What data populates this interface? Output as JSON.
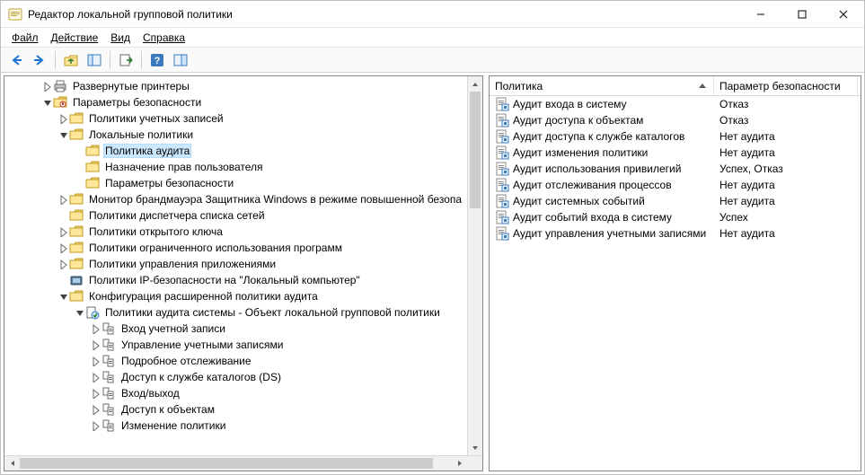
{
  "window": {
    "title": "Редактор локальной групповой политики"
  },
  "menu": {
    "file": "Файл",
    "action": "Действие",
    "view": "Вид",
    "help": "Справка"
  },
  "columns": {
    "policy": "Политика",
    "security": "Параметр безопасности"
  },
  "col_w": {
    "policy": 250,
    "security": 160
  },
  "tree": [
    {
      "depth": 1,
      "data_name": "tree-item-printers",
      "tw": "closed",
      "icon": "printer",
      "label": "Развернутые принтеры"
    },
    {
      "depth": 1,
      "data_name": "tree-item-security-settings",
      "tw": "open",
      "icon": "security",
      "label": "Параметры безопасности"
    },
    {
      "depth": 2,
      "data_name": "tree-item-account-policies",
      "tw": "closed",
      "icon": "folder",
      "label": "Политики учетных записей"
    },
    {
      "depth": 2,
      "data_name": "tree-item-local-policies",
      "tw": "open",
      "icon": "folder",
      "label": "Локальные политики"
    },
    {
      "depth": 3,
      "data_name": "tree-item-audit-policy",
      "tw": "none",
      "icon": "folder",
      "label": "Политика аудита",
      "selected": true
    },
    {
      "depth": 3,
      "data_name": "tree-item-user-rights",
      "tw": "none",
      "icon": "folder",
      "label": "Назначение прав пользователя"
    },
    {
      "depth": 3,
      "data_name": "tree-item-security-options",
      "tw": "none",
      "icon": "folder",
      "label": "Параметры безопасности"
    },
    {
      "depth": 2,
      "data_name": "tree-item-wdfw",
      "tw": "closed",
      "icon": "folder",
      "label": "Монитор брандмауэра Защитника Windows в режиме повышенной безопа"
    },
    {
      "depth": 2,
      "data_name": "tree-item-network-list",
      "tw": "none",
      "icon": "folder",
      "label": "Политики диспетчера списка сетей"
    },
    {
      "depth": 2,
      "data_name": "tree-item-public-key",
      "tw": "closed",
      "icon": "folder",
      "label": "Политики открытого ключа"
    },
    {
      "depth": 2,
      "data_name": "tree-item-software-restriction",
      "tw": "closed",
      "icon": "folder",
      "label": "Политики ограниченного использования программ"
    },
    {
      "depth": 2,
      "data_name": "tree-item-app-control",
      "tw": "closed",
      "icon": "folder",
      "label": "Политики управления приложениями"
    },
    {
      "depth": 2,
      "data_name": "tree-item-ipsec",
      "tw": "none",
      "icon": "ipsec",
      "label": "Политики IP-безопасности на \"Локальный компьютер\""
    },
    {
      "depth": 2,
      "data_name": "tree-item-adv-audit",
      "tw": "open",
      "icon": "folder",
      "label": "Конфигурация расширенной политики аудита"
    },
    {
      "depth": 3,
      "data_name": "tree-item-sys-audit",
      "tw": "open",
      "icon": "audit",
      "label": "Политики аудита системы - Объект локальной групповой политики"
    },
    {
      "depth": 4,
      "data_name": "tree-item-acct-logon",
      "tw": "closed",
      "icon": "sub",
      "label": "Вход учетной записи"
    },
    {
      "depth": 4,
      "data_name": "tree-item-acct-mgmt",
      "tw": "closed",
      "icon": "sub",
      "label": "Управление учетными записями"
    },
    {
      "depth": 4,
      "data_name": "tree-item-detailed",
      "tw": "closed",
      "icon": "sub",
      "label": "Подробное отслеживание"
    },
    {
      "depth": 4,
      "data_name": "tree-item-ds-access",
      "tw": "closed",
      "icon": "sub",
      "label": "Доступ к службе каталогов (DS)"
    },
    {
      "depth": 4,
      "data_name": "tree-item-logon-logoff",
      "tw": "closed",
      "icon": "sub",
      "label": "Вход/выход"
    },
    {
      "depth": 4,
      "data_name": "tree-item-obj-access",
      "tw": "closed",
      "icon": "sub",
      "label": "Доступ к объектам"
    },
    {
      "depth": 4,
      "data_name": "tree-item-pol-change",
      "tw": "closed",
      "icon": "sub",
      "label": "Изменение политики"
    }
  ],
  "rows": [
    {
      "data_name": "row-audit-logon",
      "policy": "Аудит входа в систему",
      "value": "Отказ"
    },
    {
      "data_name": "row-audit-obj-access",
      "policy": "Аудит доступа к объектам",
      "value": "Отказ"
    },
    {
      "data_name": "row-audit-ds-access",
      "policy": "Аудит доступа к службе каталогов",
      "value": "Нет аудита"
    },
    {
      "data_name": "row-audit-pol-change",
      "policy": "Аудит изменения политики",
      "value": "Нет аудита"
    },
    {
      "data_name": "row-audit-privilege",
      "policy": "Аудит использования привилегий",
      "value": "Успех, Отказ"
    },
    {
      "data_name": "row-audit-process",
      "policy": "Аудит отслеживания процессов",
      "value": "Нет аудита"
    },
    {
      "data_name": "row-audit-system",
      "policy": "Аудит системных событий",
      "value": "Нет аудита"
    },
    {
      "data_name": "row-audit-logon-events",
      "policy": "Аудит событий входа в систему",
      "value": "Успех"
    },
    {
      "data_name": "row-audit-account-mgmt",
      "policy": "Аудит управления учетными записями",
      "value": "Нет аудита"
    }
  ]
}
